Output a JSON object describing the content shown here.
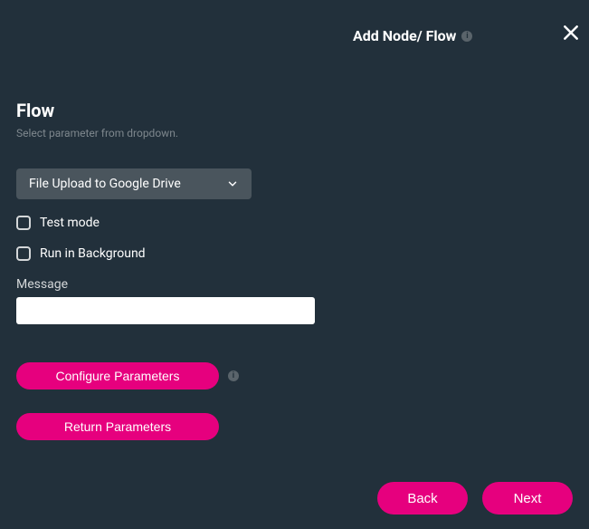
{
  "header": {
    "title": "Add Node/ Flow"
  },
  "section": {
    "title": "Flow",
    "subtitle": "Select parameter from dropdown."
  },
  "dropdown": {
    "selected": "File Upload to Google Drive"
  },
  "checkboxes": {
    "test_mode": "Test mode",
    "run_bg": "Run in Background"
  },
  "message": {
    "label": "Message",
    "value": ""
  },
  "buttons": {
    "configure": "Configure Parameters",
    "return": "Return Parameters",
    "back": "Back",
    "next": "Next"
  }
}
